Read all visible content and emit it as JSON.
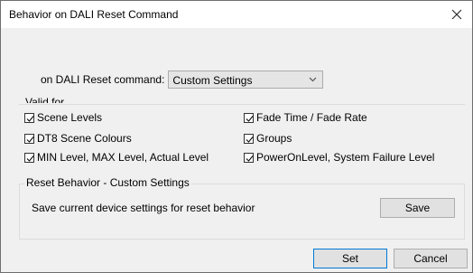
{
  "window": {
    "title": "Behavior on DALI Reset Command"
  },
  "reset_command": {
    "label": "on DALI Reset command:",
    "selected": "Custom Settings"
  },
  "valid_for": {
    "legend": "Valid for",
    "checkboxes": [
      {
        "label": "Scene Levels",
        "checked": true
      },
      {
        "label": "DT8 Scene Colours",
        "checked": true
      },
      {
        "label": "MIN Level, MAX Level, Actual Level",
        "checked": true
      },
      {
        "label": "Fade Time / Fade Rate",
        "checked": true
      },
      {
        "label": "Groups",
        "checked": true
      },
      {
        "label": "PowerOnLevel, System Failure Level",
        "checked": true
      }
    ]
  },
  "reset_behavior": {
    "legend": "Reset Behavior - Custom Settings",
    "description": "Save current device settings for reset behavior",
    "save_label": "Save"
  },
  "buttons": {
    "set_label": "Set",
    "cancel_label": "Cancel"
  }
}
